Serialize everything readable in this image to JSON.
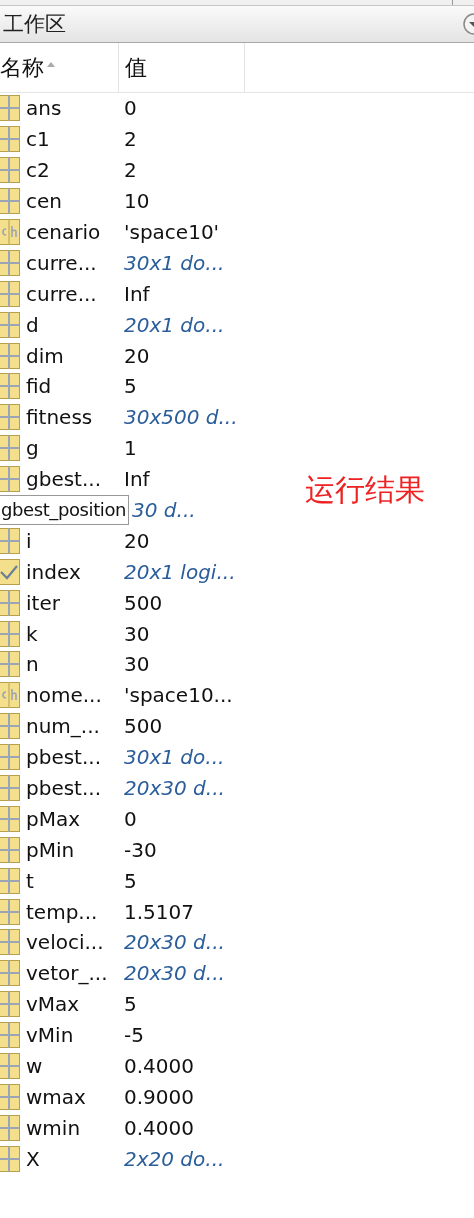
{
  "panel": {
    "title": "工作区"
  },
  "columns": [
    {
      "label": "名称",
      "sorted": true
    },
    {
      "label": "值",
      "sorted": false
    }
  ],
  "rows": [
    {
      "kind": "matrix",
      "name": "ans",
      "value": "0",
      "summary": false
    },
    {
      "kind": "matrix",
      "name": "c1",
      "value": "2",
      "summary": false
    },
    {
      "kind": "matrix",
      "name": "c2",
      "value": "2",
      "summary": false
    },
    {
      "kind": "matrix",
      "name": "cen",
      "value": "10",
      "summary": false
    },
    {
      "kind": "char",
      "name": "cenario",
      "value": "'space10'",
      "summary": false
    },
    {
      "kind": "matrix",
      "name": "curre...",
      "value": "30x1 do...",
      "summary": true
    },
    {
      "kind": "matrix",
      "name": "curre...",
      "value": "Inf",
      "summary": false
    },
    {
      "kind": "matrix",
      "name": "d",
      "value": "20x1 do...",
      "summary": true
    },
    {
      "kind": "matrix",
      "name": "dim",
      "value": "20",
      "summary": false
    },
    {
      "kind": "matrix",
      "name": "fid",
      "value": "5",
      "summary": false
    },
    {
      "kind": "matrix",
      "name": "fitness",
      "value": "30x500 d...",
      "summary": true
    },
    {
      "kind": "matrix",
      "name": "g",
      "value": "1",
      "summary": false
    },
    {
      "kind": "matrix",
      "name": "gbest...",
      "value": "Inf",
      "summary": false
    },
    {
      "kind": "tooltip",
      "tooltip": "gbest_position",
      "value": "30 d...",
      "summary": true
    },
    {
      "kind": "matrix",
      "name": "i",
      "value": "20",
      "summary": false
    },
    {
      "kind": "logical",
      "name": "index",
      "value": "20x1 logi...",
      "summary": true
    },
    {
      "kind": "matrix",
      "name": "iter",
      "value": "500",
      "summary": false
    },
    {
      "kind": "matrix",
      "name": "k",
      "value": "30",
      "summary": false
    },
    {
      "kind": "matrix",
      "name": "n",
      "value": "30",
      "summary": false
    },
    {
      "kind": "char",
      "name": "nome...",
      "value": "'space10...",
      "summary": false
    },
    {
      "kind": "matrix",
      "name": "num_...",
      "value": "500",
      "summary": false
    },
    {
      "kind": "matrix",
      "name": "pbest...",
      "value": "30x1 do...",
      "summary": true
    },
    {
      "kind": "matrix",
      "name": "pbest...",
      "value": "20x30 d...",
      "summary": true
    },
    {
      "kind": "matrix",
      "name": "pMax",
      "value": "0",
      "summary": false
    },
    {
      "kind": "matrix",
      "name": "pMin",
      "value": "-30",
      "summary": false
    },
    {
      "kind": "matrix",
      "name": "t",
      "value": "5",
      "summary": false
    },
    {
      "kind": "matrix",
      "name": "temp...",
      "value": "1.5107",
      "summary": false
    },
    {
      "kind": "matrix",
      "name": "veloci...",
      "value": "20x30 d...",
      "summary": true
    },
    {
      "kind": "matrix",
      "name": "vetor_...",
      "value": "20x30 d...",
      "summary": true
    },
    {
      "kind": "matrix",
      "name": "vMax",
      "value": "5",
      "summary": false
    },
    {
      "kind": "matrix",
      "name": "vMin",
      "value": "-5",
      "summary": false
    },
    {
      "kind": "matrix",
      "name": "w",
      "value": "0.4000",
      "summary": false
    },
    {
      "kind": "matrix",
      "name": "wmax",
      "value": "0.9000",
      "summary": false
    },
    {
      "kind": "matrix",
      "name": "wmin",
      "value": "0.4000",
      "summary": false
    },
    {
      "kind": "matrix",
      "name": "X",
      "value": "2x20 do...",
      "summary": true
    }
  ],
  "annotation": "运行结果"
}
